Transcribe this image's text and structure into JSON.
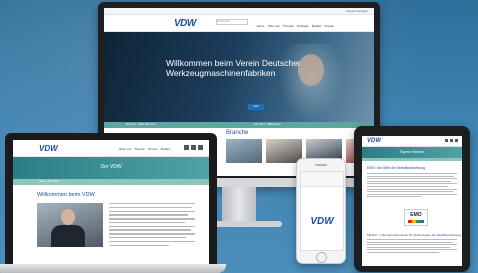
{
  "brand": {
    "logo": "VDW",
    "accent": "#1d4f9e",
    "teal": "#2a7f87"
  },
  "monitor": {
    "util_text": "Deutsch  English",
    "search_placeholder": "Suchbegriff",
    "nav": [
      "Home",
      "Über uns",
      "Themen",
      "Produkte",
      "Medien",
      "Presse"
    ],
    "hero_title": "Willkommen beim Verein Deutscher Werkzeugmaschinenfabriken",
    "hero_button": "mehr",
    "teal_items": [
      "Mai 2017 › EMO Hannover",
      "Juni 2017 › VDW-Forum"
    ],
    "section_title": "Branche"
  },
  "laptop": {
    "nav": [
      "Über uns",
      "Themen",
      "Presse",
      "Medien"
    ],
    "banner": "Der VDW",
    "crumb": "Home › Der VDW",
    "heading": "Willkommen beim VDW"
  },
  "phone": {
    "logo": "VDW"
  },
  "tablet": {
    "banner": "Eigene Messen",
    "heading": "EMO: Die Welt der Metallbearbeitung",
    "badge": "EMO",
    "subheading": "METAV – Internationale Messe für Technologien der Metallbearbeitung"
  }
}
